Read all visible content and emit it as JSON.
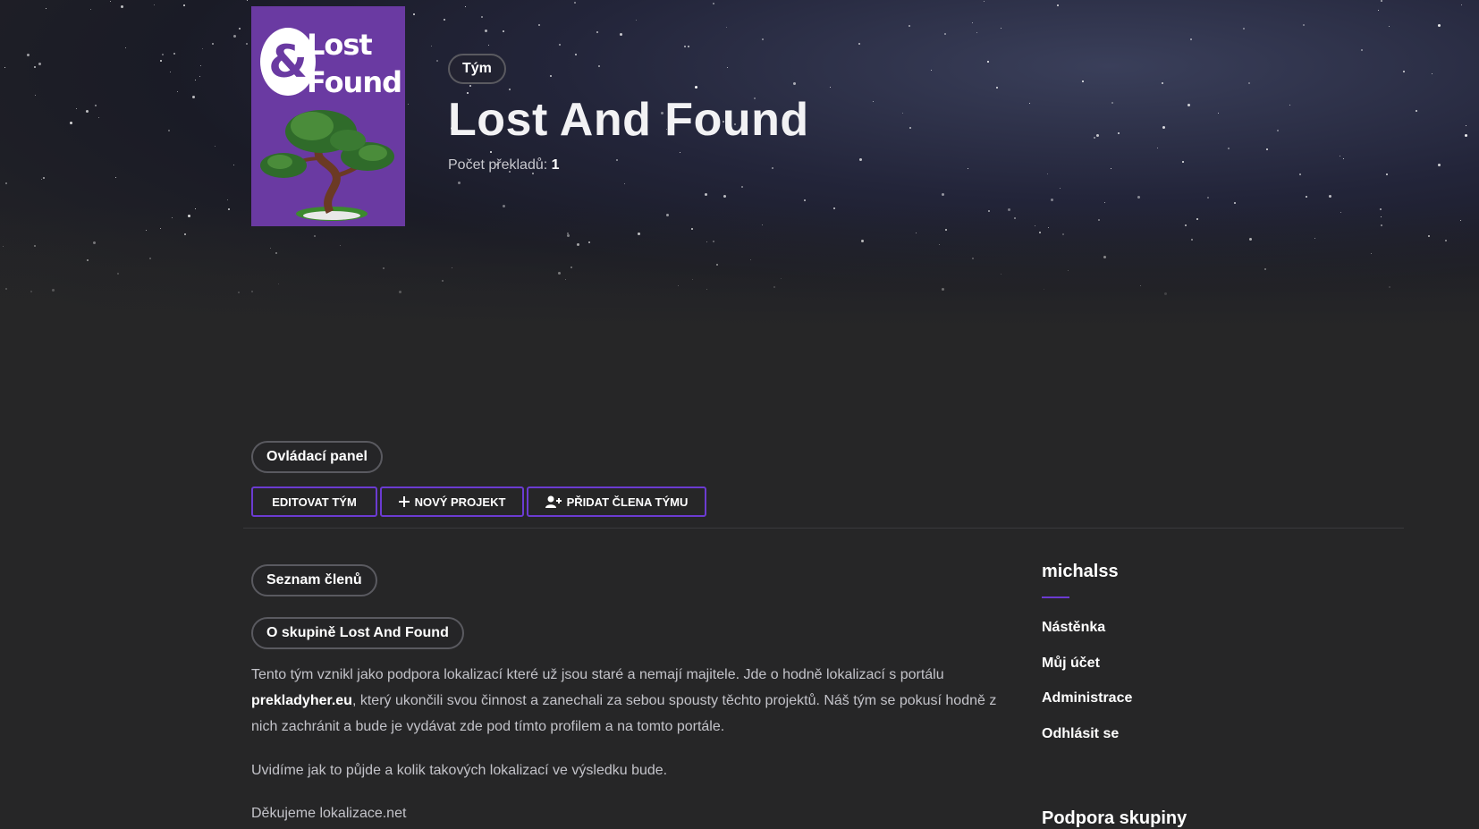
{
  "header": {
    "cover_lines": [
      "Lost",
      "Found"
    ],
    "cover_amp": "&",
    "type_badge": "Tým",
    "title": "Lost And Found",
    "count_label": "Počet překladů:",
    "count_value": "1"
  },
  "panel": {
    "label": "Ovládací panel",
    "buttons": {
      "edit": "EDITOVAT TÝM",
      "new_project": "NOVÝ PROJEKT",
      "add_member": "PŘIDAT ČLENA TÝMU"
    }
  },
  "content": {
    "members_label": "Seznam členů",
    "about_label": "O skupině Lost And Found",
    "para1_a": "Tento tým vznikl jako podpora lokalizací které už jsou staré a nemají majitele. Jde o hodně lokalizací s portálu",
    "para1_link": "prekladyher.eu",
    "para1_b": ", který ukončili svou činnost a zanechali za sebou spousty těchto projektů. Náš tým se pokusí hodně z nich zachránit a bude je vydávat zde pod tímto profilem a na tomto portále.",
    "para2": "Uvidíme jak to půjde a kolik takových lokalizací ve výsledku bude.",
    "para3": "Děkujeme lokalizace.net"
  },
  "sidebar": {
    "username": "michalss",
    "links": [
      "Nástěnka",
      "Můj účet",
      "Administrace",
      "Odhlásit se"
    ],
    "section2_title": "Podpora skupiny"
  },
  "colors": {
    "accent": "#6b3bd1",
    "cover_bg": "#6a3aa2",
    "page_bg": "#262627"
  },
  "icons": {
    "plus": "plus-icon",
    "user_add": "user-plus-icon"
  }
}
